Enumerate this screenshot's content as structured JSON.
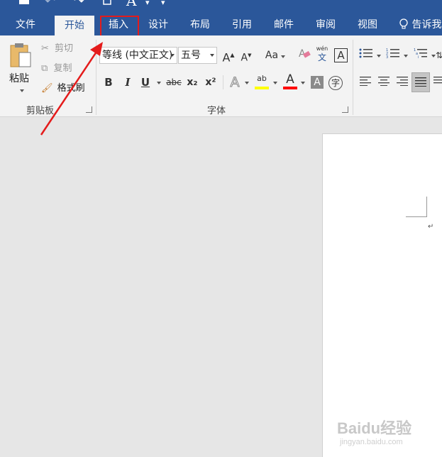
{
  "quick_access": {
    "save_icon": "save-icon",
    "undo_icon": "undo-icon",
    "redo_icon": "redo-icon",
    "new_doc_icon": "new-document-icon",
    "font_size_icon_label": "A",
    "customize_icon": "chevron-down-icon"
  },
  "tabs": [
    {
      "label": "文件"
    },
    {
      "label": "开始"
    },
    {
      "label": "插入"
    },
    {
      "label": "设计"
    },
    {
      "label": "布局"
    },
    {
      "label": "引用"
    },
    {
      "label": "邮件"
    },
    {
      "label": "审阅"
    },
    {
      "label": "视图"
    }
  ],
  "tell_me": {
    "label": "告诉我"
  },
  "clipboard": {
    "paste_label": "粘贴",
    "cut_label": "剪切",
    "copy_label": "复制",
    "format_painter_label": "格式刷",
    "group_label": "剪贴板"
  },
  "font": {
    "font_name": "等线 (中文正文)",
    "font_size": "五号",
    "grow_label": "A",
    "shrink_label": "A",
    "change_case_label": "Aa",
    "phonetic_top": "wén",
    "phonetic_bottom": "文",
    "border_char_label": "A",
    "bold_label": "B",
    "italic_label": "I",
    "underline_label": "U",
    "strikethrough_label": "abc",
    "subscript_label": "x₂",
    "superscript_label": "x²",
    "text_effects_label": "A",
    "highlight_label": "ab",
    "font_color_label": "A",
    "char_shading_label": "A",
    "enclose_char_label": "字",
    "group_label": "字体"
  },
  "colors": {
    "title_bar": "#2b579a",
    "annotation_red": "#e41b1b",
    "highlight_yellow": "#ffff00",
    "font_red": "#ff0000"
  },
  "watermark": {
    "main": "Baidu经验",
    "sub": "jingyan.baidu.com"
  }
}
